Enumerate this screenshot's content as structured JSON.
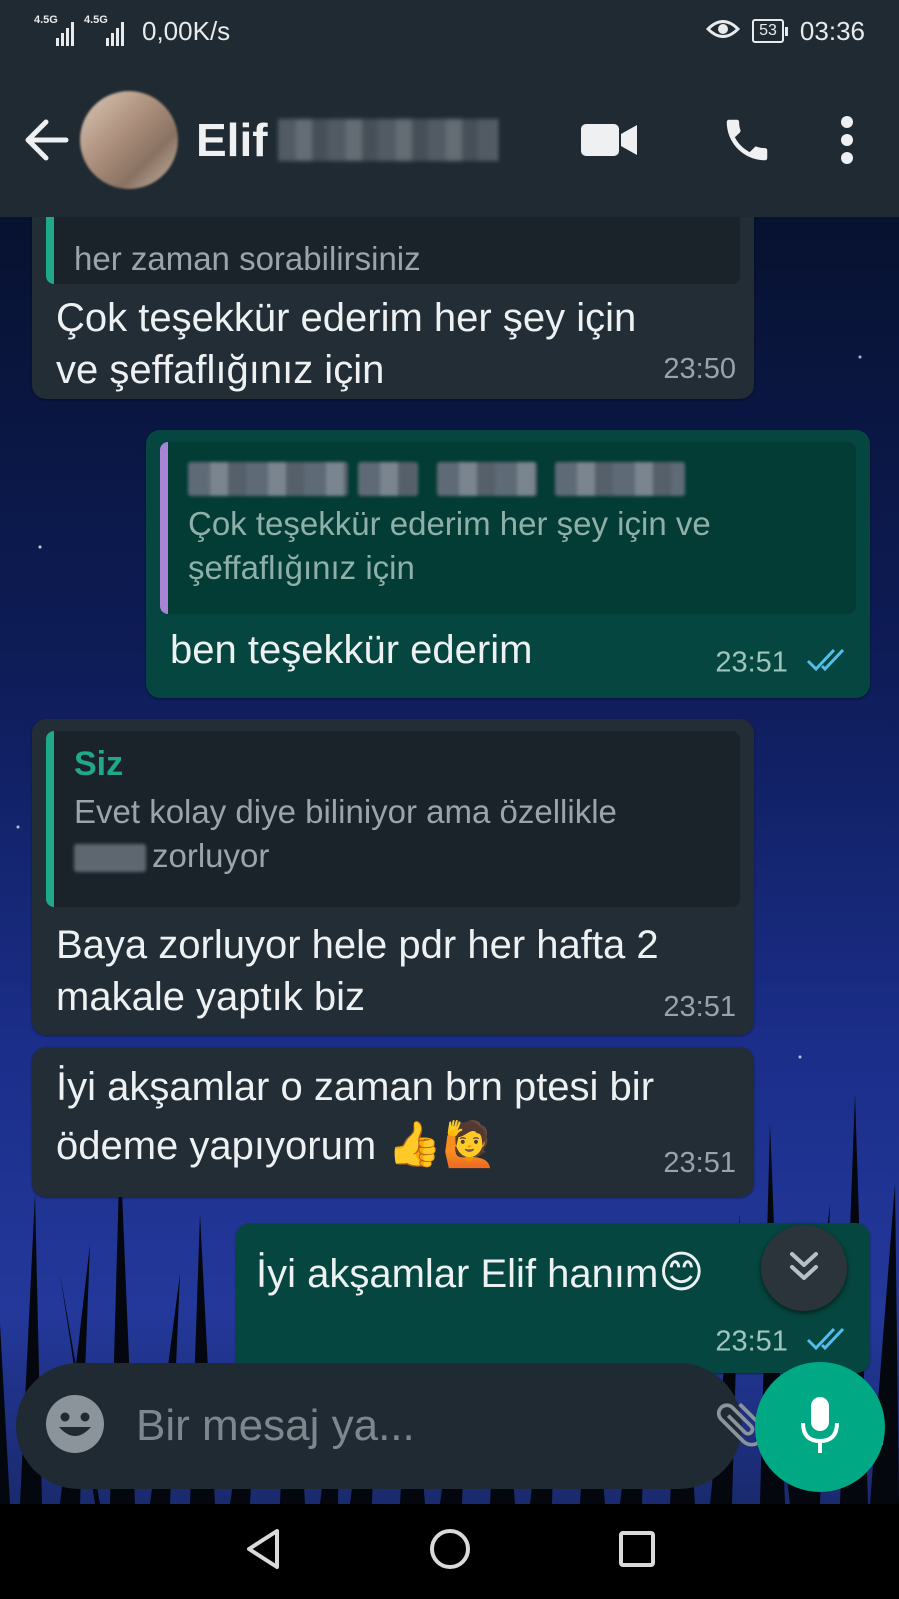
{
  "status_bar": {
    "sim1": "4.5G",
    "sim2": "4.5G",
    "speed": "0,00K/s",
    "battery": "53",
    "time": "03:36"
  },
  "header": {
    "contact_name": "Elif",
    "icons": [
      "back-arrow-icon",
      "video-call-icon",
      "phone-icon",
      "more-vert-icon"
    ]
  },
  "messages": [
    {
      "direction": "in",
      "quote_text": "her zaman sorabilirsiniz",
      "text": "Çok teşekkür ederim her şey için ve şeffaflığınız için",
      "time": "23:50"
    },
    {
      "direction": "out",
      "quote_text": "Çok teşekkür ederim her şey için ve şeffaflığınız için",
      "text": "ben teşekkür ederim",
      "time": "23:51",
      "status": "read"
    },
    {
      "direction": "in",
      "quote_author": "Siz",
      "quote_text_line1": "Evet kolay diye biliniyor ama özellikle",
      "quote_text_line2": "zorluyor",
      "text": "Baya zorluyor hele pdr her hafta 2 makale yaptık biz",
      "time": "23:51"
    },
    {
      "direction": "in",
      "text_line1": "İyi akşamlar o zaman brn ptesi bir",
      "text_line2": "ödeme yapıyorum",
      "emojis": "👍🙋",
      "time": "23:51"
    },
    {
      "direction": "out",
      "text": "İyi akşamlar Elif hanım",
      "emoji": "😊",
      "time": "23:51",
      "status": "read"
    }
  ],
  "composer": {
    "placeholder": "Bir mesaj ya..."
  },
  "colors": {
    "header_bg": "#1f2a32",
    "incoming_bubble": "#232d36",
    "outgoing_bubble": "#054740",
    "accent": "#00a884",
    "read_ticks": "#53bdeb"
  }
}
